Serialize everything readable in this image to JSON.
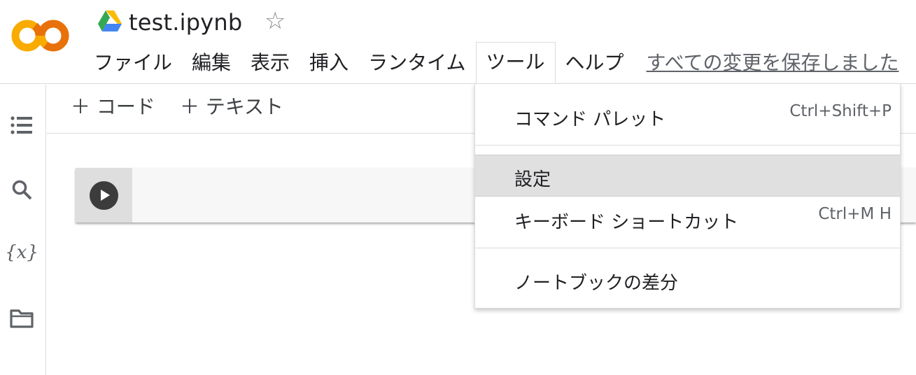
{
  "header": {
    "title": "test.ipynb",
    "star_glyph": "☆",
    "menu": [
      "ファイル",
      "編集",
      "表示",
      "挿入",
      "ランタイム",
      "ツール",
      "ヘルプ"
    ],
    "active_menu": "ツール",
    "save_status": "すべての変更を保存しました"
  },
  "toolbar": {
    "add_code": "＋ コード",
    "add_text": "＋ テキスト"
  },
  "sidebar": {
    "icons": [
      "toc-icon",
      "search-icon",
      "variables-icon",
      "folder-icon"
    ],
    "variables_glyph": "{x}"
  },
  "tools_menu": {
    "items": [
      {
        "label": "コマンド パレット",
        "shortcut": "Ctrl+Shift+P"
      },
      {
        "label": "設定",
        "shortcut": ""
      },
      {
        "label": "キーボード ショートカット",
        "shortcut": "Ctrl+M H"
      },
      {
        "label": "ノートブックの差分",
        "shortcut": ""
      }
    ]
  },
  "colors": {
    "logo_yellow": "#f9ab00",
    "logo_orange": "#e8710a",
    "menu_highlight": "#e0e0e0",
    "run_button": "#3c3c3c"
  }
}
